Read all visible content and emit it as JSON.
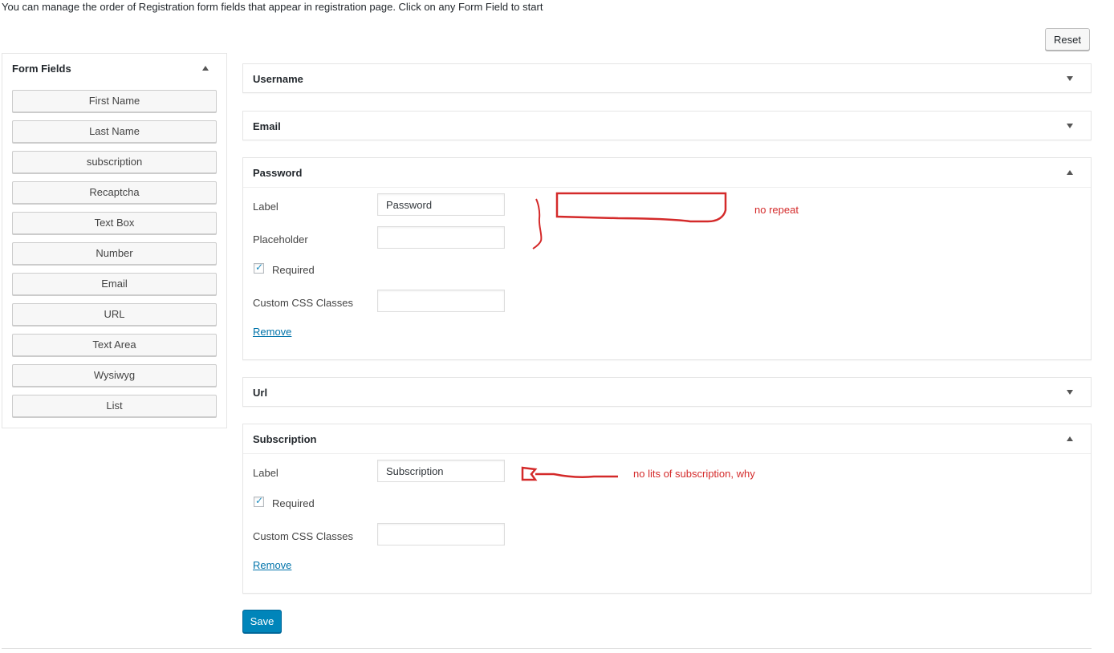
{
  "intro_text": "You can manage the order of Registration form fields that appear in registration page. Click on any Form Field to start",
  "reset_label": "Reset",
  "sidebar": {
    "title": "Form Fields",
    "items": [
      "First Name",
      "Last Name",
      "subscription",
      "Recaptcha",
      "Text Box",
      "Number",
      "Email",
      "URL",
      "Text Area",
      "Wysiwyg",
      "List"
    ]
  },
  "panels": {
    "username": {
      "title": "Username",
      "expanded": false
    },
    "email": {
      "title": "Email",
      "expanded": false
    },
    "password": {
      "title": "Password",
      "expanded": true,
      "label_text": "Label",
      "label_value": "Password",
      "placeholder_text": "Placeholder",
      "placeholder_value": "",
      "required_text": "Required",
      "required_checked": true,
      "css_text": "Custom CSS Classes",
      "css_value": "",
      "remove_text": "Remove"
    },
    "url": {
      "title": "Url",
      "expanded": false
    },
    "subscription": {
      "title": "Subscription",
      "expanded": true,
      "label_text": "Label",
      "label_value": "Subscription",
      "required_text": "Required",
      "required_checked": true,
      "css_text": "Custom CSS Classes",
      "css_value": "",
      "remove_text": "Remove"
    }
  },
  "save_label": "Save",
  "annotations": {
    "note1": "no repeat",
    "note2": "no lits of subscription, why",
    "color": "#d42a2a"
  },
  "colors": {
    "primary": "#0085ba",
    "link": "#0073aa",
    "border": "#e5e5e5"
  }
}
